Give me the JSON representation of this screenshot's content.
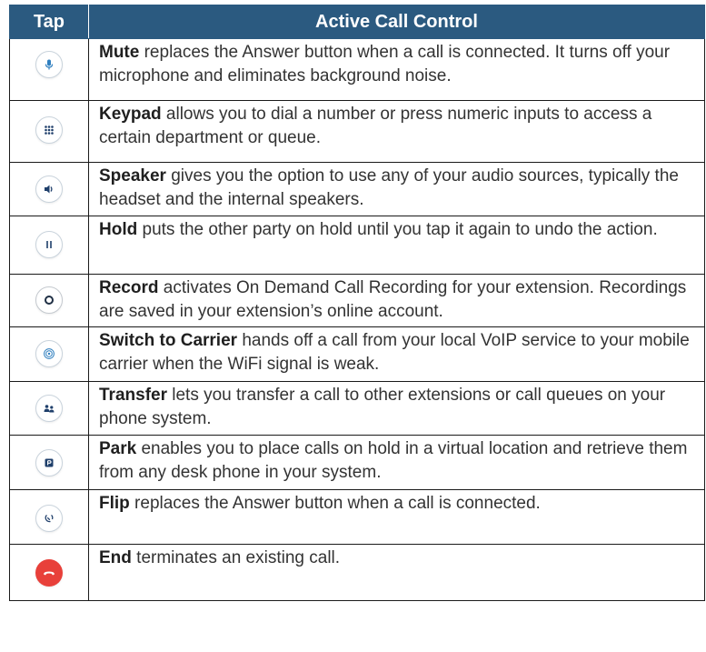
{
  "header": {
    "tap": "Tap",
    "title": "Active Call Control"
  },
  "colors": {
    "header_bg": "#2b5a80",
    "icon_blue": "#2f7fbf",
    "end_red": "#e8403a"
  },
  "rows": [
    {
      "icon": "microphone-icon",
      "term": "Mute",
      "text": " replaces the Answer button when a call is connected. It turns off your microphone and eliminates background noise."
    },
    {
      "icon": "keypad-icon",
      "term": "Keypad",
      "text": " allows you to dial a number or press numeric inputs to access a certain department or queue."
    },
    {
      "icon": "speaker-icon",
      "term": "Speaker",
      "text": " gives you the option to use any of your audio sources, typically the headset and the internal speakers."
    },
    {
      "icon": "pause-icon",
      "term": "Hold",
      "text": " puts the other party on hold until you tap it again to undo the action."
    },
    {
      "icon": "record-icon",
      "term": "Record",
      "text": " activates On Demand Call Recording for your extension. Recordings are saved in your extension’s online account."
    },
    {
      "icon": "carrier-signal-icon",
      "term": "Switch to Carrier",
      "text": " hands off a call from your local VoIP service to your mobile carrier when the WiFi signal is weak."
    },
    {
      "icon": "transfer-icon",
      "term": "Transfer",
      "text": " lets you transfer a call to other extensions or call queues on your phone system."
    },
    {
      "icon": "park-icon",
      "term": "Park",
      "text": " enables you to place calls on hold in a virtual location and retrieve them from any desk phone in your system."
    },
    {
      "icon": "flip-icon",
      "term": "Flip",
      "text": " replaces the Answer button when a call is connected."
    },
    {
      "icon": "end-call-icon",
      "term": "End",
      "text": " terminates an existing call."
    }
  ]
}
